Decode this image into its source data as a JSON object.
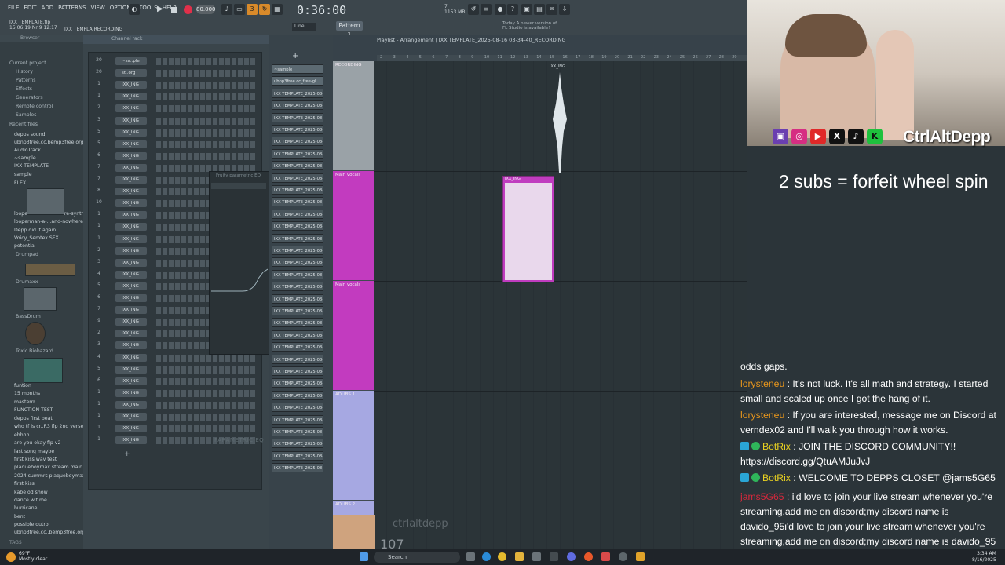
{
  "menu": [
    "FILE",
    "EDIT",
    "ADD",
    "PATTERNS",
    "VIEW",
    "OPTIONS",
    "TOOLS",
    "HELP"
  ],
  "transport": {
    "tempo": "80.000",
    "time": "0:36:00",
    "pattern": "Pattern 1",
    "snap": "Line",
    "cpu": "7",
    "mem": "1153 MB"
  },
  "file": {
    "name": "IXX TEMPLATE.flp",
    "date": "15:06:19 Nr 9 12:17",
    "recording": "IXX TEMPLA RECORDING"
  },
  "hint": {
    "line1": "Today  A newer version of",
    "line2": "FL Studio is available!"
  },
  "browser": {
    "header": "Browser",
    "items": [
      "Current project",
      "History",
      "Patterns",
      "Effects",
      "Generators",
      "Remote control",
      "Samples",
      "Recent files",
      "depps sound",
      "ubnp3free.cc.bemp3free.org",
      "AudioTrack",
      "~sample",
      "IXX TEMPLATE",
      "sample",
      "FLEX",
      "looperman-l-2...-future-synth",
      "looperman-a-...and-nowhere",
      "Depp did it again",
      "Voicy_Semtex SFX",
      "potential",
      "Drumpad",
      "Drumaxx",
      "BassDrum",
      "Toxic Biohazard",
      "funtion",
      "15 months",
      "masterrr",
      "FUNCTION TEST",
      "depps first beat",
      "who tf is cr..R3 flp 2nd verse",
      "ehhhh",
      "are you okay flp v2",
      "last song maybe",
      "first kiss wav test",
      "plaqueboymax stream main",
      "2024 summrs plaqueboymax",
      "first kiss",
      "kabe od show",
      "dance wit me",
      "hurricane",
      "bent",
      "possible outro",
      "ubnp3free.cc..bemp3free.org"
    ],
    "footer": "TAGS"
  },
  "rack": {
    "header": "Channel rack",
    "rows": [
      {
        "num": "20",
        "name": "~sa..ple"
      },
      {
        "num": "20",
        "name": "st..org"
      },
      {
        "num": "1",
        "name": "IXX_ING"
      },
      {
        "num": "1",
        "name": "IXX_ING"
      },
      {
        "num": "2",
        "name": "IXX_ING"
      },
      {
        "num": "3",
        "name": "IXX_ING"
      },
      {
        "num": "5",
        "name": "IXX_ING"
      },
      {
        "num": "5",
        "name": "IXX_ING"
      },
      {
        "num": "6",
        "name": "IXX_ING"
      },
      {
        "num": "7",
        "name": "IXX_ING"
      },
      {
        "num": "7",
        "name": "IXX_ING"
      },
      {
        "num": "8",
        "name": "IXX_ING"
      },
      {
        "num": "10",
        "name": "IXX_ING"
      },
      {
        "num": "1",
        "name": "IXX_ING"
      },
      {
        "num": "1",
        "name": "IXX_ING"
      },
      {
        "num": "1",
        "name": "IXX_ING"
      },
      {
        "num": "2",
        "name": "IXX_ING"
      },
      {
        "num": "3",
        "name": "IXX_ING"
      },
      {
        "num": "4",
        "name": "IXX_ING"
      },
      {
        "num": "5",
        "name": "IXX_ING"
      },
      {
        "num": "6",
        "name": "IXX_ING"
      },
      {
        "num": "7",
        "name": "IXX_ING"
      },
      {
        "num": "9",
        "name": "IXX_ING"
      },
      {
        "num": "2",
        "name": "IXX_ING"
      },
      {
        "num": "3",
        "name": "IXX_ING"
      },
      {
        "num": "4",
        "name": "IXX_ING"
      },
      {
        "num": "5",
        "name": "IXX_ING"
      },
      {
        "num": "6",
        "name": "IXX_ING"
      },
      {
        "num": "1",
        "name": "IXX_ING"
      },
      {
        "num": "1",
        "name": "IXX_ING"
      },
      {
        "num": "1",
        "name": "IXX_ING"
      },
      {
        "num": "1",
        "name": "IXX_ING"
      },
      {
        "num": "1",
        "name": "IXX_ING"
      }
    ],
    "eq_title": "Fruity parametric EQ",
    "eq_label": "PARAMETRIC EQ"
  },
  "picker": [
    "~sample",
    "ubnp3free.cc_free-gl..",
    "IXX TEMPLATE_2025-08-1",
    "IXX TEMPLATE_2025-08-1",
    "IXX TEMPLATE_2025-08-1",
    "IXX TEMPLATE_2025-08-1",
    "IXX TEMPLATE_2025-08-1",
    "IXX TEMPLATE_2025-08-1",
    "IXX TEMPLATE_2025-08-1",
    "IXX TEMPLATE_2025-08-1",
    "IXX TEMPLATE_2025-08-1",
    "IXX TEMPLATE_2025-08-1",
    "IXX TEMPLATE_2025-08-1",
    "IXX TEMPLATE_2025-08-1",
    "IXX TEMPLATE_2025-08-1",
    "IXX TEMPLATE_2025-08-1",
    "IXX TEMPLATE_2025-08-1",
    "IXX TEMPLATE_2025-08-1",
    "IXX TEMPLATE_2025-08-1",
    "IXX TEMPLATE_2025-08-1",
    "IXX TEMPLATE_2025-08-1",
    "IXX TEMPLATE_2025-08-1",
    "IXX TEMPLATE_2025-08-1",
    "IXX TEMPLATE_2025-08-1",
    "IXX TEMPLATE_2025-08-1",
    "IXX TEMPLATE_2025-08-1",
    "IXX TEMPLATE_2025-08-1",
    "IXX TEMPLATE_2025-08-1",
    "IXX TEMPLATE_2025-08-1",
    "IXX TEMPLATE_2025-08-1",
    "IXX TEMPLATE_2025-08-1",
    "IXX TEMPLATE_2025-08-1",
    "IXX TEMPLATE_2025-08-1",
    "IXX TEMPLATE_2025-08-1"
  ],
  "playlist": {
    "title": "Playlist - Arrangement  |  IXX TEMPLATE_2025-08-16 03-34-40_RECORDING",
    "ruler": [
      "2",
      "3",
      "4",
      "5",
      "6",
      "7",
      "8",
      "9",
      "10",
      "11",
      "12",
      "13",
      "14",
      "15",
      "16",
      "17",
      "18",
      "19",
      "20",
      "21",
      "22",
      "23",
      "24",
      "25",
      "26",
      "27",
      "28",
      "29"
    ],
    "tracks": [
      {
        "label": "RECORDING",
        "color": "#9aa2a7"
      },
      {
        "label": "Main vocals",
        "color": "#c23bbf"
      },
      {
        "label": "Main vocals",
        "color": "#c23bbf"
      },
      {
        "label": "ADLIBS 1",
        "color": "#a6a8e2"
      },
      {
        "label": "ADLIBS 2",
        "color": "#a6a8e2"
      }
    ],
    "clip_rec": "IXX_ING",
    "clip_main": "IXX_ING"
  },
  "stream": {
    "handle": "CtrlAltDepp",
    "subs_goal": "2 subs = forfeit wheel spin",
    "viewers": "107",
    "tag": "ctrlaltdepp",
    "chat": [
      {
        "user": "",
        "text": "odds gaps.",
        "color": "#ffffff"
      },
      {
        "user": "lorysteneu",
        "text": "It's not luck. It's all math and strategy. I started small and scaled up once I got the hang of it.",
        "color": "#e8961c"
      },
      {
        "user": "lorysteneu",
        "text": "If you are interested, message me on Discord at verndex02 and I'll walk you through how it works.",
        "color": "#e8961c"
      },
      {
        "user": "BotRix",
        "text": "JOIN THE DISCORD COMMUNITY!! https://discord.gg/QtuAMJuJvJ",
        "color": "#e8d021"
      },
      {
        "user": "BotRix",
        "text": "WELCOME TO DEPPS CLOSET @jams5G65",
        "color": "#e8d021"
      },
      {
        "user": "jams5G65",
        "text": "i'd love to join your live stream whenever you're streaming,add me on discord;my discord name is davido_95i'd love to join your live stream whenever you're streaming,add me on discord;my discord name is davido_95",
        "color": "#d9283c"
      }
    ]
  },
  "taskbar": {
    "weather_temp": "69°F",
    "weather_desc": "Mostly clear",
    "search": "Search",
    "time": "3:34 AM",
    "date": "8/16/2025"
  },
  "colors": {
    "accent": "#c23bbf",
    "record": "#e0304a",
    "chat_bot": "#e8d021"
  }
}
